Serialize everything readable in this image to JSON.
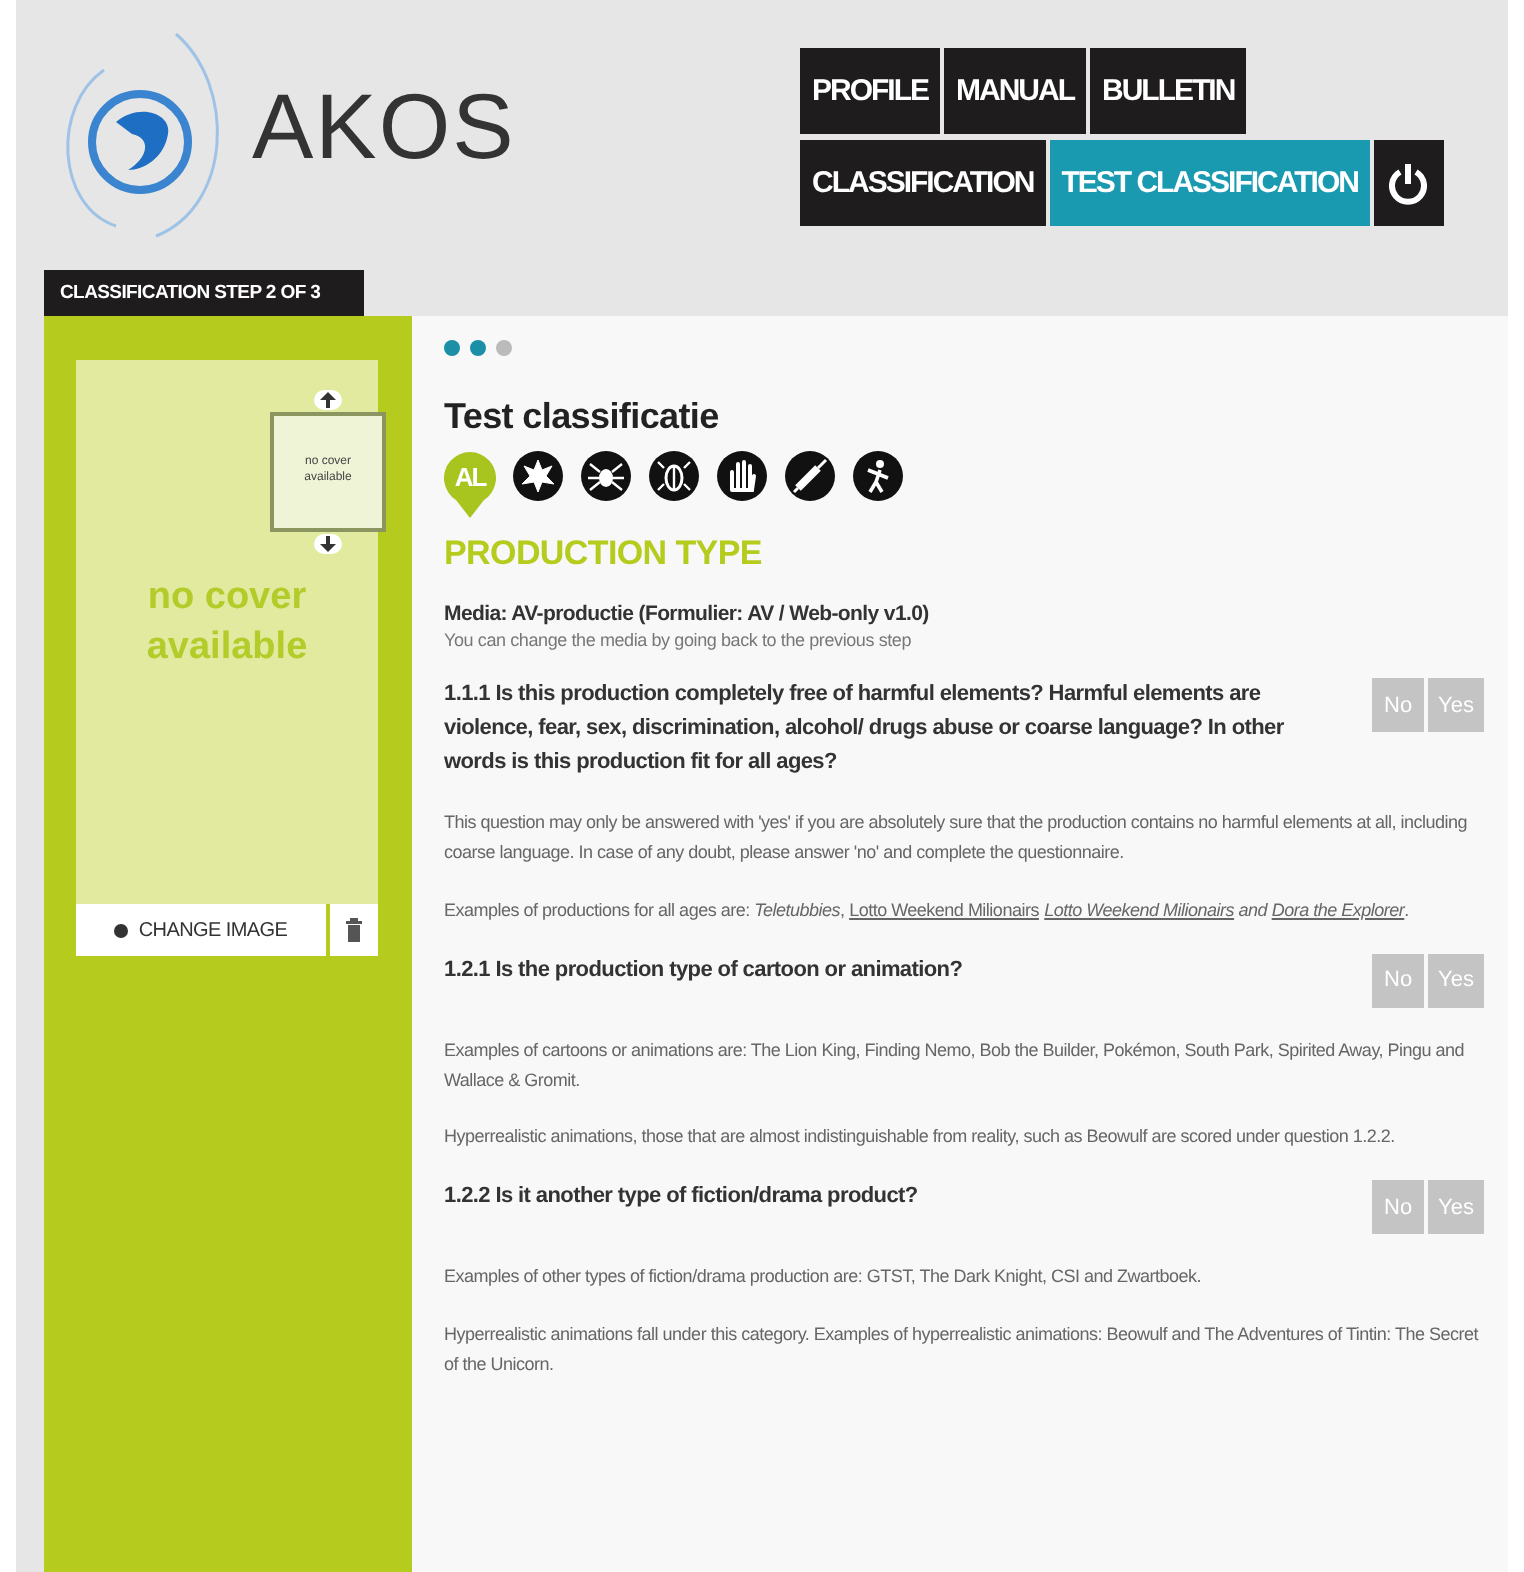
{
  "logo": {
    "text": "AKOS"
  },
  "nav": [
    [
      {
        "label": "PROFILE",
        "selected": false
      },
      {
        "label": "MANUAL",
        "selected": false
      },
      {
        "label": "BULLETIN",
        "selected": false
      }
    ],
    [
      {
        "label": "CLASSIFICATION",
        "selected": false
      },
      {
        "label": "TEST CLASSIFICATION",
        "selected": true
      }
    ]
  ],
  "step_tab": "CLASSIFICATION STEP 2 OF 3",
  "cover": {
    "placeholder": "no cover available",
    "thumbnail": "no cover available",
    "change_button": "CHANGE IMAGE"
  },
  "steps": [
    {
      "done": true
    },
    {
      "done": true
    },
    {
      "done": false
    }
  ],
  "title": "Test classificatie",
  "rating_badge": "AL",
  "section_title": "PRODUCTION TYPE",
  "media": {
    "label": "Media: AV-productie (Formulier: AV / Web-only v1.0)",
    "hint": "You can change the media by going back to the previous step"
  },
  "questions": [
    {
      "text": "1.1.1 Is this production completely free of harmful elements? Harmful elements are violence, fear, sex, discrimination, alcohol/ drugs abuse or coarse language? In other words is this production fit for all ages?",
      "answers": [
        {
          "label": "No",
          "selected": false
        },
        {
          "label": "Yes",
          "selected": false
        }
      ],
      "notes": [
        [
          {
            "kind": "text",
            "text": "This question may only be answered with 'yes' if you are absolutely sure that the production contains no harmful elements at all, including coarse language. In case of any doubt, please answer 'no' and complete the questionnaire."
          }
        ],
        [
          {
            "kind": "text",
            "text": "Examples of productions for all ages are: *Teletubbies*, "
          },
          {
            "kind": "link",
            "text": "Lotto Weekend Milionairs"
          },
          {
            "kind": "link",
            "text": "*Lotto Weekend Milionairs*"
          },
          {
            "kind": "text",
            "text": " *and* "
          },
          {
            "kind": "link",
            "text": "*Dora the Explorer*"
          },
          {
            "kind": "text",
            "text": "."
          }
        ]
      ]
    },
    {
      "text": "1.2.1 Is the production type of cartoon or animation?",
      "answers": [
        {
          "label": "No",
          "selected": false
        },
        {
          "label": "Yes",
          "selected": false
        }
      ],
      "notes": [
        [
          {
            "kind": "text",
            "text": "Examples of cartoons or animations are: The Lion King, Finding Nemo, Bob the Builder, Pokémon, South Park, Spirited Away, Pingu and Wallace & Gromit."
          }
        ],
        [
          {
            "kind": "text",
            "text": "Hyperrealistic animations, those that are almost indistinguishable from reality, such as Beowulf are scored under question 1.2.2."
          }
        ]
      ]
    },
    {
      "text": "1.2.2 Is it another type of fiction/drama product?",
      "answers": [
        {
          "label": "No",
          "selected": false
        },
        {
          "label": "Yes",
          "selected": false
        }
      ],
      "notes": [
        [
          {
            "kind": "text",
            "text": "Examples of other types of fiction/drama production are: GTST, The Dark Knight, CSI and Zwartboek."
          }
        ],
        [
          {
            "kind": "text",
            "text": "Hyperrealistic animations fall under this category. Examples of hyperrealistic animations: Beowulf and The Adventures of Tintin: The Secret of the Unicorn."
          }
        ]
      ]
    }
  ]
}
